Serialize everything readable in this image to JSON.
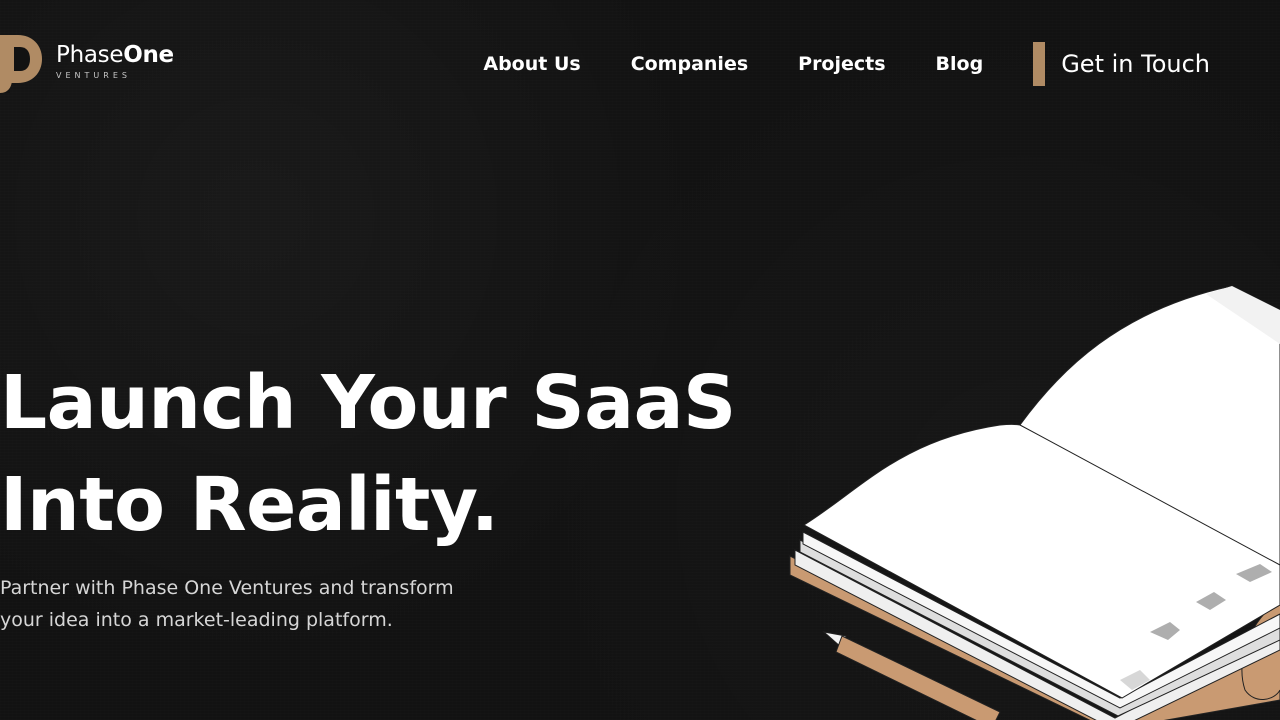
{
  "header": {
    "logo": {
      "name_light": "Phase",
      "name_bold": "One",
      "sub": "VENTURES"
    },
    "nav": [
      {
        "label": "About Us"
      },
      {
        "label": "Companies"
      },
      {
        "label": "Projects"
      },
      {
        "label": "Blog"
      }
    ],
    "cta": {
      "label": "Get in Touch"
    }
  },
  "hero": {
    "title_line1": "Launch Your SaaS",
    "title_line2": "Into Reality.",
    "subtitle_line1": "Partner with Phase One Ventures and transform",
    "subtitle_line2": "your idea into a market-leading platform."
  },
  "colors": {
    "background": "#121212",
    "accent": "#b08b64",
    "text": "#ffffff",
    "subtext": "#d6d6d6"
  },
  "icons": {
    "logo_mark": "phase-one-logo-icon",
    "illustration": "open-notebook-illustration"
  }
}
